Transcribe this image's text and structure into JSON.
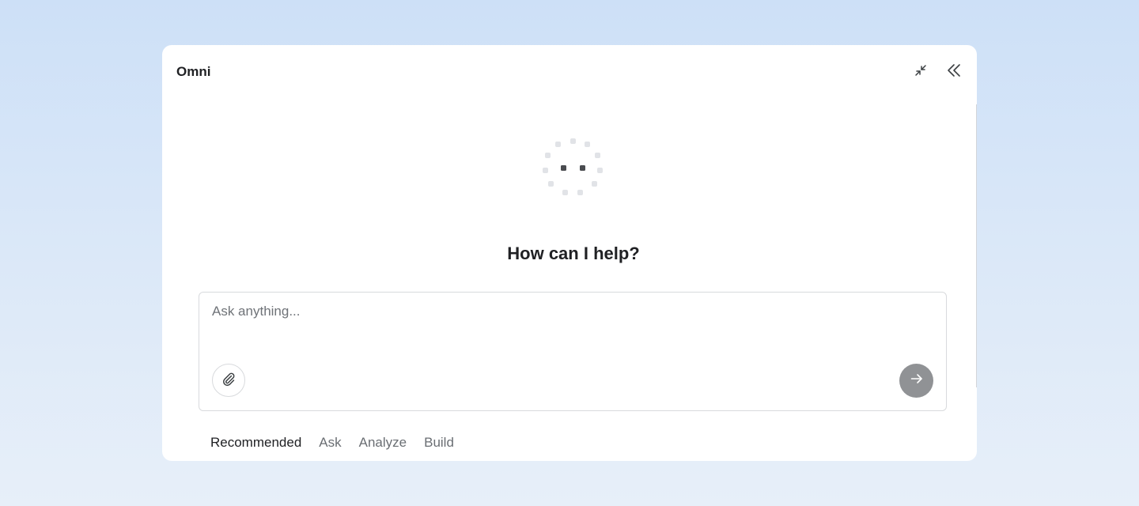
{
  "app": {
    "title": "Omni"
  },
  "header": {
    "collapse_icon": "minimize-arrows-icon",
    "close_icon": "double-chevron-left-icon"
  },
  "main": {
    "heading": "How can I help?",
    "loader_icon": "loading-dots-icon"
  },
  "composer": {
    "placeholder": "Ask anything...",
    "value": "",
    "attach_icon": "paperclip-icon",
    "send_icon": "arrow-right-icon"
  },
  "tabs": [
    {
      "label": "Recommended",
      "active": true
    },
    {
      "label": "Ask",
      "active": false
    },
    {
      "label": "Analyze",
      "active": false
    },
    {
      "label": "Build",
      "active": false
    }
  ],
  "colors": {
    "background_top": "#cde0f7",
    "background_bottom": "#e7eff9",
    "panel": "#ffffff",
    "send_button": "#909295",
    "text_primary": "#202124",
    "text_secondary": "#6a6e73"
  }
}
